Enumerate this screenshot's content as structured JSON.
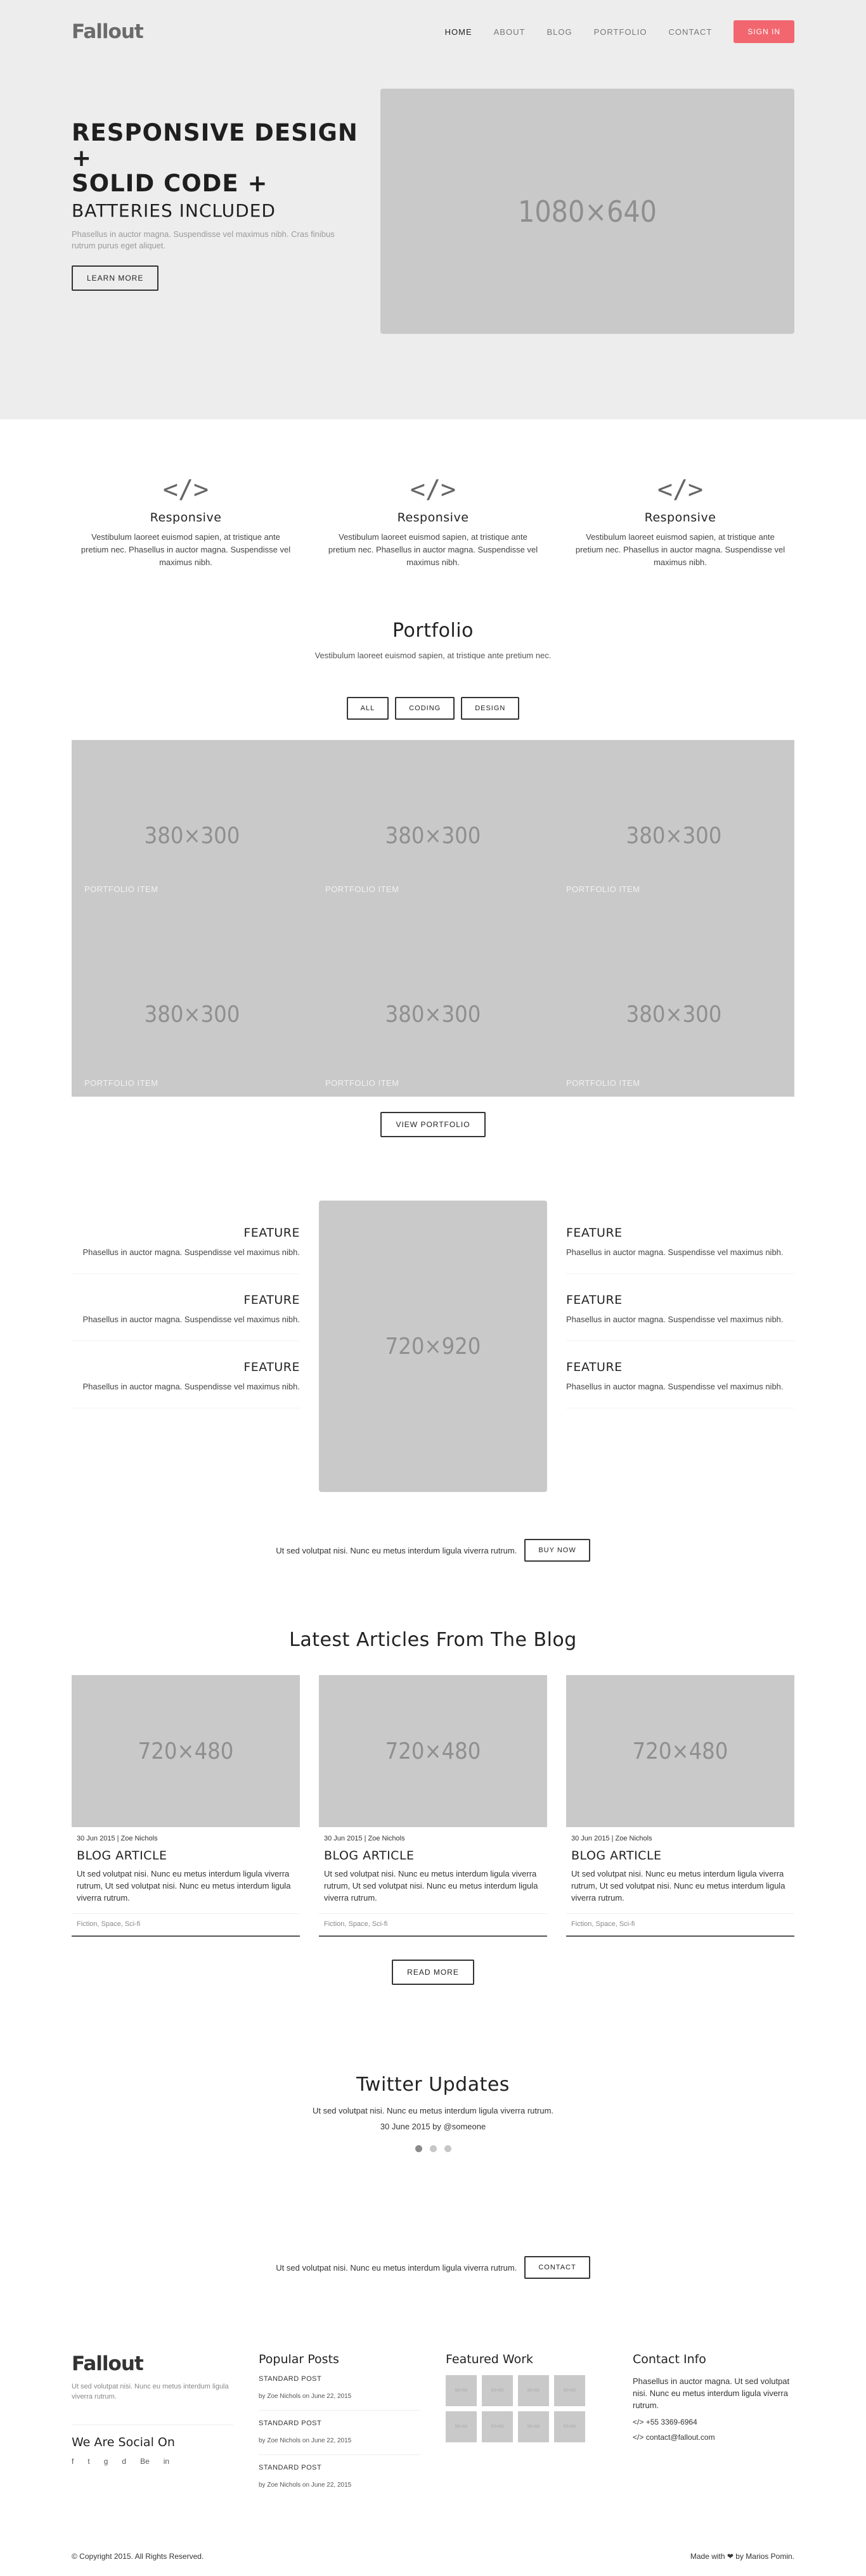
{
  "brand": {
    "logo": "Fallout"
  },
  "nav": {
    "items": [
      "HOME",
      "ABOUT",
      "BLOG",
      "PORTFOLIO",
      "CONTACT"
    ],
    "signin": "SIGN IN"
  },
  "hero": {
    "line1": "RESPONSIVE DESIGN +",
    "line2": "SOLID CODE +",
    "line3": "BATTERIES INCLUDED",
    "text": "Phasellus in auctor magna. Suspendisse vel maximus nibh. Cras finibus rutrum purus eget aliquet.",
    "button": "LEARN MORE",
    "image": "1080×640"
  },
  "services": [
    {
      "icon": "</>",
      "title": "Responsive",
      "text": "Vestibulum laoreet euismod sapien, at tristique ante pretium nec. Phasellus in auctor magna. Suspendisse vel maximus nibh."
    },
    {
      "icon": "</>",
      "title": "Responsive",
      "text": "Vestibulum laoreet euismod sapien, at tristique ante pretium nec. Phasellus in auctor magna. Suspendisse vel maximus nibh."
    },
    {
      "icon": "</>",
      "title": "Responsive",
      "text": "Vestibulum laoreet euismod sapien, at tristique ante pretium nec. Phasellus in auctor magna. Suspendisse vel maximus nibh."
    }
  ],
  "portfolio": {
    "title": "Portfolio",
    "subtitle": "Vestibulum laoreet euismod sapien, at tristique ante pretium nec.",
    "filters": [
      "ALL",
      "CODING",
      "DESIGN"
    ],
    "items": [
      {
        "image": "380×300",
        "label": "PORTFOLIO ITEM"
      },
      {
        "image": "380×300",
        "label": "PORTFOLIO ITEM"
      },
      {
        "image": "380×300",
        "label": "PORTFOLIO ITEM"
      },
      {
        "image": "380×300",
        "label": "PORTFOLIO ITEM"
      },
      {
        "image": "380×300",
        "label": "PORTFOLIO ITEM"
      },
      {
        "image": "380×300",
        "label": "PORTFOLIO ITEM"
      }
    ],
    "button": "VIEW PORTFOLIO"
  },
  "features": {
    "left": [
      {
        "title": "FEATURE",
        "text": "Phasellus in auctor magna. Suspendisse vel maximus nibh."
      },
      {
        "title": "FEATURE",
        "text": "Phasellus in auctor magna. Suspendisse vel maximus nibh."
      },
      {
        "title": "FEATURE",
        "text": "Phasellus in auctor magna. Suspendisse vel maximus nibh."
      }
    ],
    "right": [
      {
        "title": "FEATURE",
        "text": "Phasellus in auctor magna. Suspendisse vel maximus nibh."
      },
      {
        "title": "FEATURE",
        "text": "Phasellus in auctor magna. Suspendisse vel maximus nibh."
      },
      {
        "title": "FEATURE",
        "text": "Phasellus in auctor magna. Suspendisse vel maximus nibh."
      }
    ],
    "image": "720×920"
  },
  "cta1": {
    "text": "Ut sed volutpat nisi. Nunc eu metus interdum ligula viverra rutrum.",
    "button": "BUY NOW"
  },
  "blog": {
    "title": "Latest Articles From The Blog",
    "cards": [
      {
        "image": "720×480",
        "meta": "30 Jun 2015 | Zoe Nichols",
        "title": "BLOG ARTICLE",
        "text": "Ut sed volutpat nisi. Nunc eu metus interdum ligula viverra rutrum, Ut sed volutpat nisi. Nunc eu metus interdum ligula viverra rutrum.",
        "tags": "Fiction, Space, Sci-fi"
      },
      {
        "image": "720×480",
        "meta": "30 Jun 2015 | Zoe Nichols",
        "title": "BLOG ARTICLE",
        "text": "Ut sed volutpat nisi. Nunc eu metus interdum ligula viverra rutrum, Ut sed volutpat nisi. Nunc eu metus interdum ligula viverra rutrum.",
        "tags": "Fiction, Space, Sci-fi"
      },
      {
        "image": "720×480",
        "meta": "30 Jun 2015 | Zoe Nichols",
        "title": "BLOG ARTICLE",
        "text": "Ut sed volutpat nisi. Nunc eu metus interdum ligula viverra rutrum, Ut sed volutpat nisi. Nunc eu metus interdum ligula viverra rutrum.",
        "tags": "Fiction, Space, Sci-fi"
      }
    ],
    "button": "READ MORE"
  },
  "twitter": {
    "title": "Twitter Updates",
    "text": "Ut sed volutpat nisi. Nunc eu metus interdum ligula viverra rutrum.",
    "byline": "30 June 2015 by @someone"
  },
  "cta2": {
    "text": "Ut sed volutpat nisi. Nunc eu metus interdum ligula viverra rutrum.",
    "button": "CONTACT"
  },
  "footer": {
    "logo": "Fallout",
    "about": "Ut sed volutpat nisi. Nunc eu metus interdum ligula viverra rutrum.",
    "social_title": "We Are Social On",
    "social": [
      "f",
      "t",
      "g",
      "d",
      "Be",
      "in"
    ],
    "posts_title": "Popular Posts",
    "posts": [
      {
        "title": "STANDARD POST",
        "by": "by Zoe Nichols on June 22, 2015"
      },
      {
        "title": "STANDARD POST",
        "by": "by Zoe Nichols on June 22, 2015"
      },
      {
        "title": "STANDARD POST",
        "by": "by Zoe Nichols on June 22, 2015"
      }
    ],
    "work_title": "Featured Work",
    "work_thumb": "50×50",
    "contact_title": "Contact Info",
    "contact_text": "Phasellus in auctor magna. Ut sed volutpat nisi. Nunc eu metus interdum ligula viverra rutrum.",
    "phone": "+55 3369-6964",
    "email": "contact@fallout.com",
    "copyright": "© Copyright 2015. All Rights Reserved.",
    "made_with_prefix": "Made with",
    "made_with_suffix": "by Marios Pomin."
  },
  "colors": {
    "accent": "#f2676f",
    "hero_bg": "#ededed",
    "placeholder": "#c9c9c9"
  }
}
